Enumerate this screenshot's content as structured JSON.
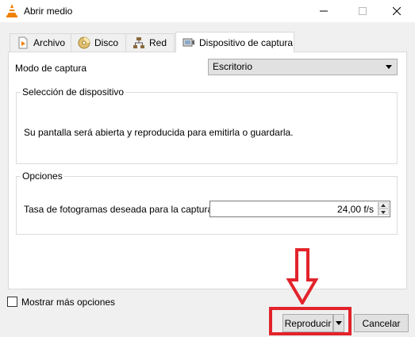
{
  "window": {
    "title": "Abrir medio",
    "controls": {
      "minimize": "—",
      "maximize": "☐",
      "close": "✕"
    }
  },
  "tabs": [
    {
      "label": "Archivo",
      "icon": "file-play-icon",
      "active": false
    },
    {
      "label": "Disco",
      "icon": "disc-icon",
      "active": false
    },
    {
      "label": "Red",
      "icon": "network-icon",
      "active": false
    },
    {
      "label": "Dispositivo de captura",
      "icon": "capture-device-icon",
      "active": true
    }
  ],
  "capture": {
    "mode_label": "Modo de captura",
    "mode_value": "Escritorio"
  },
  "device_group": {
    "title": "Selección de dispositivo",
    "message": "Su pantalla será abierta y reproducida para emitirla o guardarla."
  },
  "options_group": {
    "title": "Opciones",
    "framerate_label": "Tasa de fotogramas deseada para la captura.",
    "framerate_value": "24,00 f/s"
  },
  "more_options": {
    "label": "Mostrar más opciones",
    "checked": false
  },
  "buttons": {
    "play": "Reproducir",
    "cancel": "Cancelar"
  },
  "annotation": {
    "color": "#e2232b"
  }
}
